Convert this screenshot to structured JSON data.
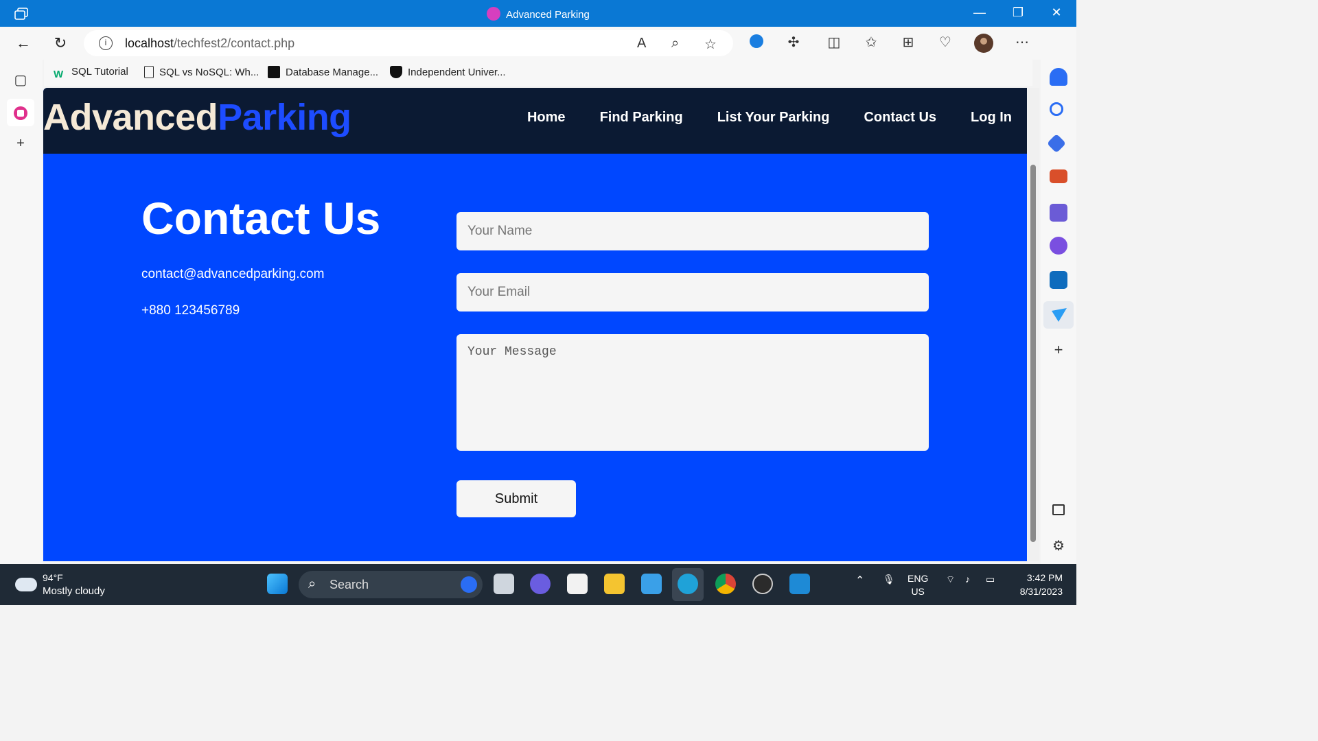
{
  "browser": {
    "window_title": "Advanced Parking",
    "url_host": "localhost",
    "url_path": "/techfest2/contact.php",
    "bookmarks": [
      "SQL Tutorial",
      "SQL vs NoSQL: Wh...",
      "Database Manage...",
      "Independent Univer..."
    ]
  },
  "site": {
    "logo_main": "Advanced",
    "logo_accent": "Parking",
    "nav": [
      "Home",
      "Find Parking",
      "List Your Parking",
      "Contact Us",
      "Log In"
    ]
  },
  "contact": {
    "title": "Contact Us",
    "email": "contact@advancedparking.com",
    "phone": "+880 123456789"
  },
  "form": {
    "name_placeholder": "Your Name",
    "email_placeholder": "Your Email",
    "message_placeholder": "Your Message",
    "submit_label": "Submit"
  },
  "taskbar": {
    "temperature": "94°F",
    "condition": "Mostly cloudy",
    "search_label": "Search",
    "lang_top": "ENG",
    "lang_bottom": "US",
    "time": "3:42 PM",
    "date": "8/31/2023"
  },
  "colors": {
    "page_bg": "#0047ff",
    "header_bg": "#0b1a33",
    "logo_accent": "#1d4cff",
    "titlebar": "#0a78d4"
  }
}
